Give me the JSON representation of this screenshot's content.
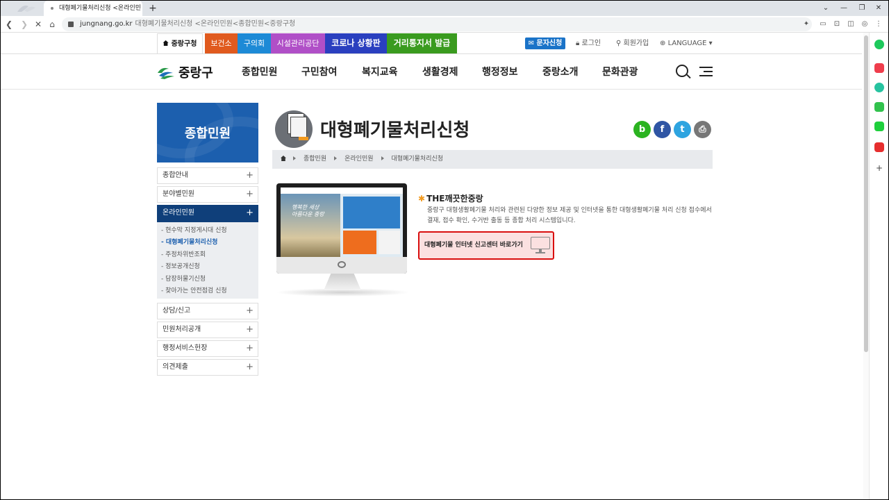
{
  "browser": {
    "tab_title": "대형폐기물처리신청 <온라인민",
    "url_domain": "jungnang.go.kr",
    "url_rest": "대형폐기물처리신청 <온라인민원<종합민원<중랑구청",
    "new_tab_label": "+",
    "minimize": "—",
    "restore": "❐",
    "close": "✕",
    "back": "❮",
    "forward": "❯",
    "stop": "✕",
    "home": "⌂"
  },
  "util": {
    "tabs": [
      {
        "label": "중랑구청",
        "color": "#ffffff"
      },
      {
        "label": "보건소",
        "color": "#e05a1e"
      },
      {
        "label": "구의회",
        "color": "#1d8ad6"
      },
      {
        "label": "시설관리공단",
        "color": "#b04fc7"
      },
      {
        "label": "코로나 상황판",
        "color": "#2a3fbf"
      },
      {
        "label": "거리통지서 발급",
        "color": "#3a9b1f"
      }
    ],
    "sms_label": "문자신청",
    "login": "로그인",
    "join": "회원가입",
    "language": "LANGUAGE"
  },
  "gnb": {
    "logo": "중랑구",
    "items": [
      "종합민원",
      "구민참여",
      "복지교육",
      "생활경제",
      "행정정보",
      "중랑소개",
      "문화관광"
    ]
  },
  "lnb": {
    "title": "종합민원",
    "items": [
      "종합안내",
      "분야별민원",
      "온라인민원",
      "상담/신고",
      "민원처리공개",
      "행정서비스헌장",
      "의견제출"
    ],
    "plus": "+",
    "sub_items": [
      "현수막 지정게시대 신청",
      "대형폐기물처리신청",
      "주정차위반조회",
      "정보공개신청",
      "담장허물기신청",
      "찾아가는 안전점검 신청"
    ],
    "sub_prefix": "- "
  },
  "content": {
    "title": "대형폐기물처리신청",
    "breadcrumb": [
      "종합민원",
      "온라인민원",
      "대형폐기물처리신청"
    ],
    "sns": [
      {
        "label": "b",
        "color": "#2bb320"
      },
      {
        "label": "f",
        "color": "#2f55a4"
      },
      {
        "label": "t",
        "color": "#2ea4e0"
      },
      {
        "label": "⎙",
        "color": "#777777"
      }
    ],
    "promo_title": "THE깨끗한중랑",
    "promo_star": "✱",
    "promo_desc": "중랑구 대형생활폐기물 처리와 관련된 다양한 정보 제공 및 인터넷을 통한 대형생활폐기물 처리 신청 접수에서 결재, 접수 확인, 수거반 출동 등 종합 처리 시스템입니다.",
    "report_button": "대형폐기물 인터넷 신고센터 바로가기",
    "screen_text": "행복한 세상\n아름다운 중랑"
  }
}
